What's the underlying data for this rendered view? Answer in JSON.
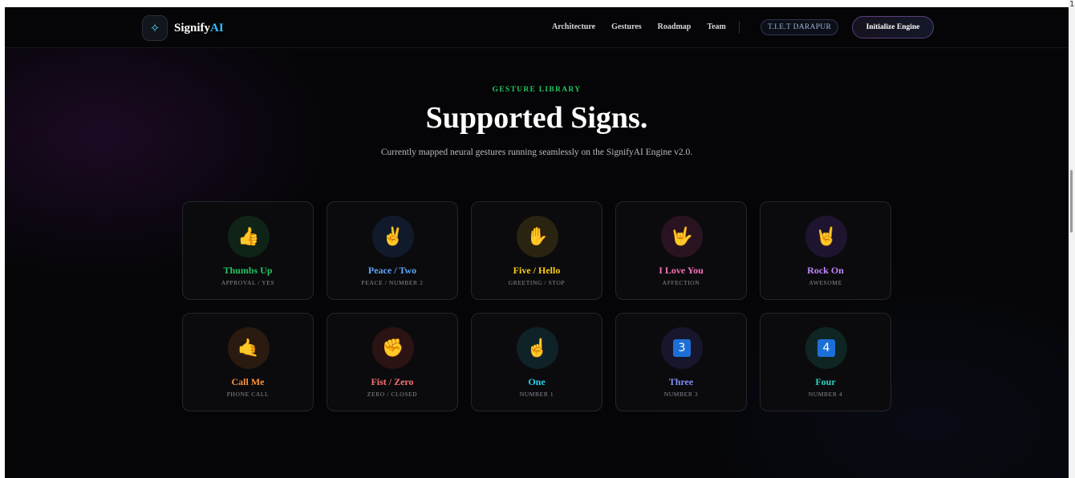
{
  "brand": {
    "name_main": "Signify",
    "name_accent": "AI",
    "logo_icon": "sparkles-icon"
  },
  "nav": {
    "links": [
      "Architecture",
      "Gestures",
      "Roadmap",
      "Team"
    ],
    "badge": "T.I.E.T DARAPUR",
    "cta": "Initialize Engine"
  },
  "hero": {
    "eyebrow": "GESTURE LIBRARY",
    "title": "Supported Signs.",
    "subtitle": "Currently mapped neural gestures running seamlessly on the SignifyAI Engine v2.0."
  },
  "gestures": [
    {
      "title": "Thumbs Up",
      "sub": "APPROVAL / YES",
      "glyph": "👍",
      "icon": "thumbs-up-icon",
      "color": "#22c55e",
      "tint": "#0f2416"
    },
    {
      "title": "Peace / Two",
      "sub": "PEACE / NUMBER 2",
      "glyph": "✌️",
      "icon": "peace-icon",
      "color": "#60a5fa",
      "tint": "#111a2b"
    },
    {
      "title": "Five / Hello",
      "sub": "GREETING / STOP",
      "glyph": "✋",
      "icon": "open-hand-icon",
      "color": "#facc15",
      "tint": "#2a2310"
    },
    {
      "title": "I Love You",
      "sub": "AFFECTION",
      "glyph": "🤟",
      "icon": "love-you-icon",
      "color": "#f472b6",
      "tint": "#2a1320"
    },
    {
      "title": "Rock On",
      "sub": "AWESOME",
      "glyph": "🤘",
      "icon": "rock-on-icon",
      "color": "#c084fc",
      "tint": "#1f1430"
    },
    {
      "title": "Call Me",
      "sub": "PHONE CALL",
      "glyph": "🤙",
      "icon": "call-me-icon",
      "color": "#fb923c",
      "tint": "#2b1a0f"
    },
    {
      "title": "Fist / Zero",
      "sub": "ZERO / CLOSED",
      "glyph": "✊",
      "icon": "fist-icon",
      "color": "#f87171",
      "tint": "#2b1213"
    },
    {
      "title": "One",
      "sub": "NUMBER 1",
      "glyph": "☝️",
      "icon": "point-up-icon",
      "color": "#22d3ee",
      "tint": "#0f2228"
    },
    {
      "title": "Three",
      "sub": "NUMBER 3",
      "glyph": "3",
      "icon": "number-three-icon",
      "color": "#818cf8",
      "tint": "#17162c",
      "box": true
    },
    {
      "title": "Four",
      "sub": "NUMBER 4",
      "glyph": "4",
      "icon": "number-four-icon",
      "color": "#2dd4bf",
      "tint": "#0f2523",
      "box": true
    }
  ],
  "scroll_marker": "1"
}
